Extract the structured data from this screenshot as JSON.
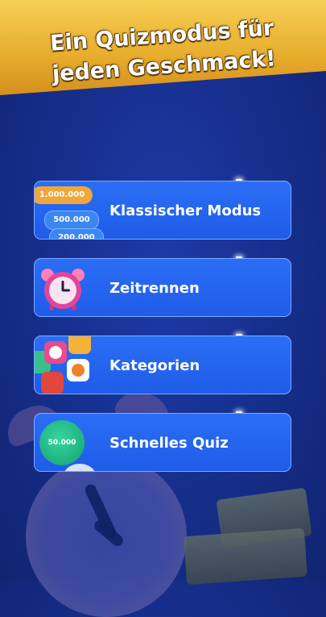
{
  "banner": {
    "line1": "Ein Quizmodus für",
    "line2": "jeden Geschmack!"
  },
  "modes": [
    {
      "label": "Klassischer Modus",
      "icon": "money-stack-icon",
      "pills": [
        "1.000.000",
        "500.000",
        "200.000"
      ]
    },
    {
      "label": "Zeitrennen",
      "icon": "alarm-clock-icon"
    },
    {
      "label": "Kategorien",
      "icon": "category-tiles-icon"
    },
    {
      "label": "Schnelles Quiz",
      "icon": "coin-icon",
      "coin_value": "50.000"
    }
  ],
  "colors": {
    "background": "#17308f",
    "button": "#2563f0",
    "banner": "#f0c040"
  }
}
